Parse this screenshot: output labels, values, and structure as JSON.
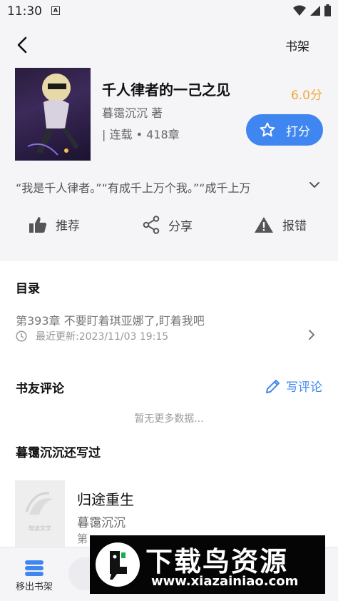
{
  "status_bar": {
    "time": "11:30",
    "a_label": "A"
  },
  "header": {
    "shelf_label": "书架"
  },
  "book": {
    "title": "千人律者的一己之见",
    "author": "暮霭沉沉 著",
    "meta": "| 连载 • 418章",
    "rating": "6.0分",
    "rate_label": "打分",
    "intro": "“我是千人律者。”“有成千上万个我。”“成千上万"
  },
  "actions": {
    "recommend": "推荐",
    "share": "分享",
    "report": "报错"
  },
  "toc": {
    "title": "目录",
    "latest_chapter": "第393章 不要盯着琪亚娜了,盯着我吧",
    "last_update": "最近更新:2023/11/03 19:15"
  },
  "reviews": {
    "title": "书友评论",
    "write_label": "写评论",
    "empty": "暂无更多数据..."
  },
  "author_works": {
    "title": "暮霭沉沉还写过",
    "cover_text": "塔读文学",
    "book_title": "归途重生",
    "book_author": "暮霭沉沉",
    "book_meta": "第"
  },
  "bottom": {
    "remove_label": "移出书架"
  },
  "watermark": {
    "title": "下载鸟资源",
    "url": "www.xiazainiao.com"
  },
  "colors": {
    "accent": "#3f86f0",
    "rating": "#f2a73b",
    "background": "#f5f5f8"
  }
}
